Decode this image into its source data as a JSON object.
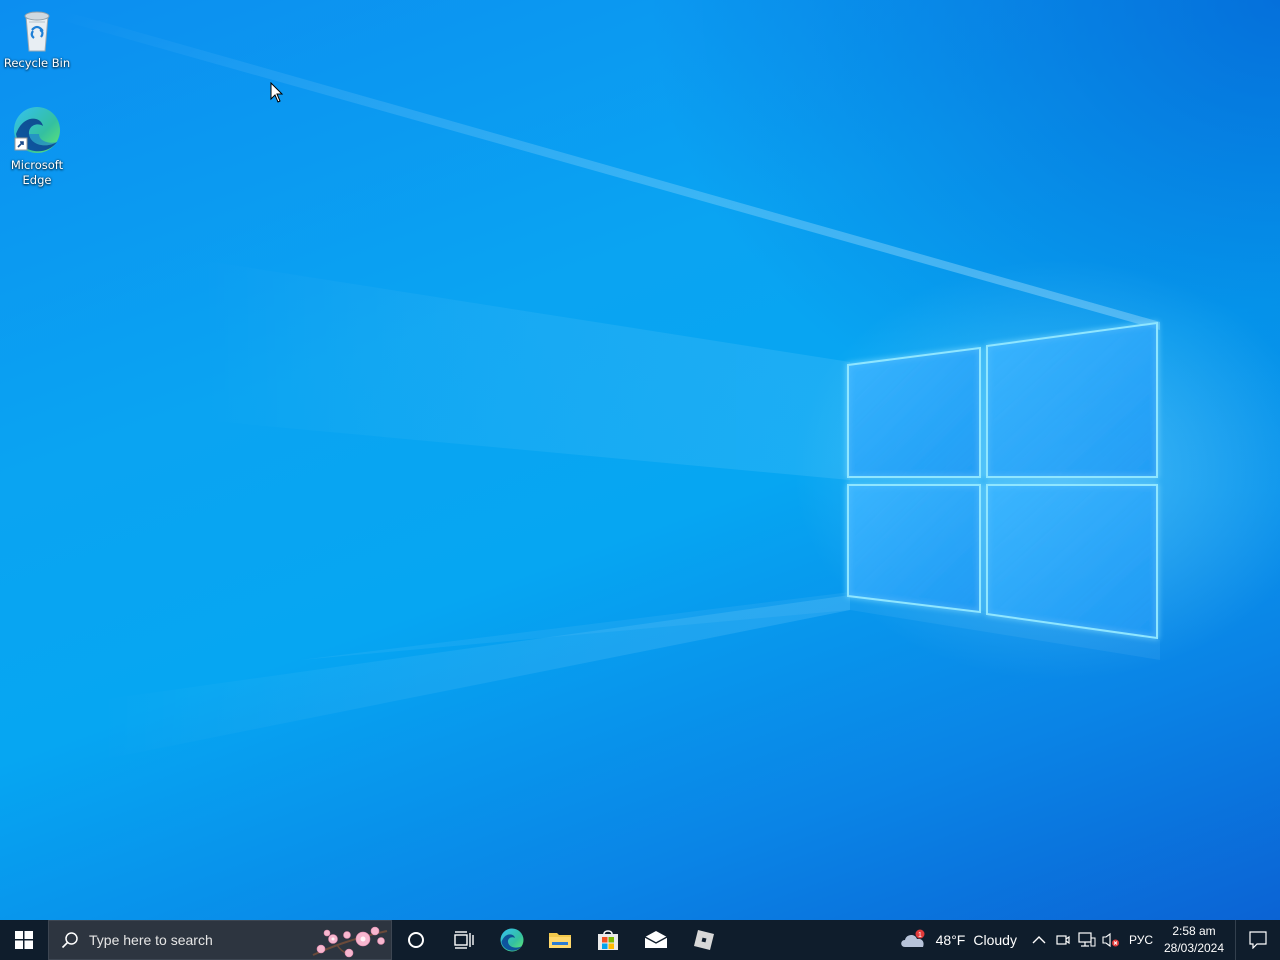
{
  "desktop": {
    "icons": [
      {
        "label": "Recycle Bin",
        "icon": "recycle-bin-icon"
      },
      {
        "label": "Microsoft Edge",
        "icon": "edge-icon"
      }
    ],
    "wallpaper": "windows-10-hero",
    "accent": "#0aa4f2"
  },
  "taskbar": {
    "start_icon": "windows-start-icon",
    "search_placeholder": "Type here to search",
    "pinned": [
      {
        "name": "cortana",
        "icon": "cortana-circle-icon"
      },
      {
        "name": "task-view",
        "icon": "task-view-icon"
      },
      {
        "name": "edge",
        "icon": "edge-icon"
      },
      {
        "name": "file-explorer",
        "icon": "folder-icon"
      },
      {
        "name": "microsoft-store",
        "icon": "store-icon"
      },
      {
        "name": "mail",
        "icon": "mail-icon"
      },
      {
        "name": "roblox",
        "icon": "roblox-icon"
      }
    ],
    "weather": {
      "temp": "48°F",
      "condition": "Cloudy",
      "badge": "1"
    },
    "language": "РУС",
    "time": "2:58 am",
    "date": "28/03/2024",
    "background": "#0f1d2c"
  }
}
